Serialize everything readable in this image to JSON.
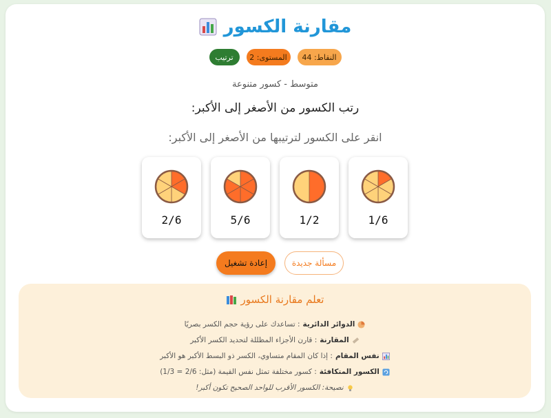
{
  "header": {
    "title": "مقارنة الكسور",
    "title_icon": "bar-chart-icon"
  },
  "badges": {
    "points": "النقاط: 44",
    "level": "المستوى: 2",
    "mode": "ترتيب"
  },
  "subtitle": "متوسط - كسور متنوعة",
  "question": "رتب الكسور من الأصغر إلى الأكبر:",
  "instruction": "انقر على الكسور لترتيبها من الأصغر إلى الأكبر:",
  "fractions": [
    {
      "label": "1/6",
      "numerator": 1,
      "denominator": 6
    },
    {
      "label": "1/2",
      "numerator": 1,
      "denominator": 2
    },
    {
      "label": "5/6",
      "numerator": 5,
      "denominator": 6
    },
    {
      "label": "2/6",
      "numerator": 2,
      "denominator": 6
    }
  ],
  "buttons": {
    "new_problem": "مسألة جديدة",
    "restart": "إعادة تشغيل"
  },
  "learn": {
    "title": "تعلم مقارنة الكسور",
    "title_icon": "books-icon",
    "items": [
      {
        "icon": "pie-icon",
        "term": "الدوائر الدائرية",
        "text": ": تساعدك على رؤية حجم الكسر بصريًا"
      },
      {
        "icon": "ruler-icon",
        "term": "المقارنة",
        "text": ": قارن الأجزاء المظللة لتحديد الكسر الأكبر"
      },
      {
        "icon": "chart-icon",
        "term": "نفس المقام",
        "text": ": إذا كان المقام متساوي، الكسر ذو البسط الأكبر هو الأكبر"
      },
      {
        "icon": "refresh-icon",
        "term": "الكسور المتكافئة",
        "text": ": كسور مختلفة تمثل نفس القيمة (مثل: 2/6 = 1/3)"
      }
    ],
    "tip_icon": "lightbulb-icon",
    "tip": "نصيحة: الكسور الأقرب للواحد الصحيح تكون أكبر!"
  },
  "colors": {
    "title": "#2196d8",
    "filled": "#ff6d2a",
    "empty": "#ffd27a",
    "pie_border": "#8a5a44",
    "accent": "#f47b1e",
    "learn_bg": "#fdf0da"
  }
}
